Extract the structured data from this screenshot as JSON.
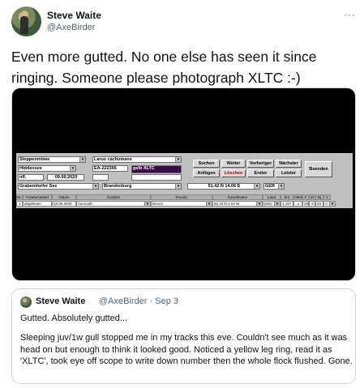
{
  "author": {
    "name": "Steve Waite",
    "handle": "@AxeBirder"
  },
  "more_icon": "···",
  "tweet": {
    "text": "Even more gutted. No one else has seen it since ringing. Someone please photograph XLTC :-)"
  },
  "screenshot_app": {
    "species_de": "Steppenmöwe",
    "species_lat": "Larus cachinnans",
    "location1": "Hiddensee",
    "ring_number": "EA-222366",
    "ring_color": "gelb  XLTC",
    "age": "nfl.",
    "ring_date": "09.06.2020",
    "location2": "Grabendorfer See",
    "state": "Brandenburg",
    "coordinates": "51.42 N  14.06 E",
    "country": "GER",
    "buttons": {
      "suchen": "Suchen",
      "weiter": "Weiter",
      "vorheriger": "Vorheriger",
      "naechster": "Nächster",
      "beenden": "Beenden",
      "anfuegen": "Anfügen",
      "loeschen": "Löschen",
      "erster": "Erster",
      "letzter": "Letzter"
    },
    "table_headers": [
      "Nr.",
      "Fundumstand",
      "Datum",
      "Fundort",
      "Provinz",
      "Koordinaten",
      "Land",
      "km",
      "Alter",
      "F",
      "M",
      "Bj",
      "V"
    ],
    "row": {
      "nr": "1",
      "fundumstand": "abgelesen",
      "datum": "03.09.2020",
      "fundort": "Axmouth",
      "provinz": "Devon",
      "koordinaten": "50.43 N    3.03 W",
      "land": "ENG",
      "km": "1.197",
      "alter": "1",
      "f": "20",
      "m": "9",
      "bj": "20",
      "v": "A"
    }
  },
  "quote": {
    "name": "Steve Waite",
    "handle": "@AxeBirder · Sep 3",
    "line1": "Gutted. Absolutely gutted...",
    "line2": "Sleeping juv/1w gull stopped me in my tracks this eve. Couldn't see much as it was head on but enough to think it looked good. Noticed a yellow leg ring, read it as 'XLTC', took eye off scope to write down number then the whole flock flushed. Gone."
  }
}
